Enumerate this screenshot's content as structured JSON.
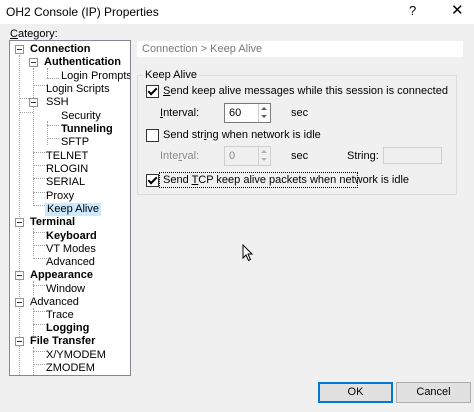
{
  "window": {
    "title": "OH2 Console (IP) Properties",
    "help": "?",
    "close": "✕"
  },
  "category": {
    "label_underlined": "C",
    "label_rest": "ategory:"
  },
  "tree": [
    {
      "label": "Connection",
      "bold": true
    },
    {
      "label": "Authentication",
      "bold": true
    },
    {
      "label": "Login Prompts"
    },
    {
      "label": "Login Scripts"
    },
    {
      "label": "SSH"
    },
    {
      "label": "Security"
    },
    {
      "label": "Tunneling",
      "bold": true
    },
    {
      "label": "SFTP"
    },
    {
      "label": "TELNET"
    },
    {
      "label": "RLOGIN"
    },
    {
      "label": "SERIAL"
    },
    {
      "label": "Proxy"
    },
    {
      "label": "Keep Alive",
      "selected": true
    },
    {
      "label": "Terminal",
      "bold": true
    },
    {
      "label": "Keyboard",
      "bold": true
    },
    {
      "label": "VT Modes"
    },
    {
      "label": "Advanced"
    },
    {
      "label": "Appearance",
      "bold": true
    },
    {
      "label": "Window"
    },
    {
      "label": "Advanced"
    },
    {
      "label": "Trace"
    },
    {
      "label": "Logging",
      "bold": true
    },
    {
      "label": "File Transfer",
      "bold": true
    },
    {
      "label": "X/YMODEM"
    },
    {
      "label": "ZMODEM"
    }
  ],
  "header": {
    "breadcrumb": "Connection > Keep Alive"
  },
  "keepalive": {
    "group_title": "Keep Alive",
    "send_messages": {
      "checked": true,
      "u": "S",
      "rest": "end keep alive messages while this session is connected"
    },
    "interval1": {
      "u": "I",
      "rest": "nterval:",
      "value": "60",
      "unit": "sec"
    },
    "send_string": {
      "checked": false,
      "pre": "Send str",
      "u": "i",
      "rest": "ng when network is idle"
    },
    "interval2": {
      "pre": "Inte",
      "u": "r",
      "rest": "val:",
      "value": "0",
      "unit": "sec"
    },
    "string_label": "String:",
    "send_tcp": {
      "checked": true,
      "pre": "Send ",
      "u": "T",
      "rest": "CP keep alive packets when network is idle"
    }
  },
  "buttons": {
    "ok": "OK",
    "cancel": "Cancel"
  }
}
